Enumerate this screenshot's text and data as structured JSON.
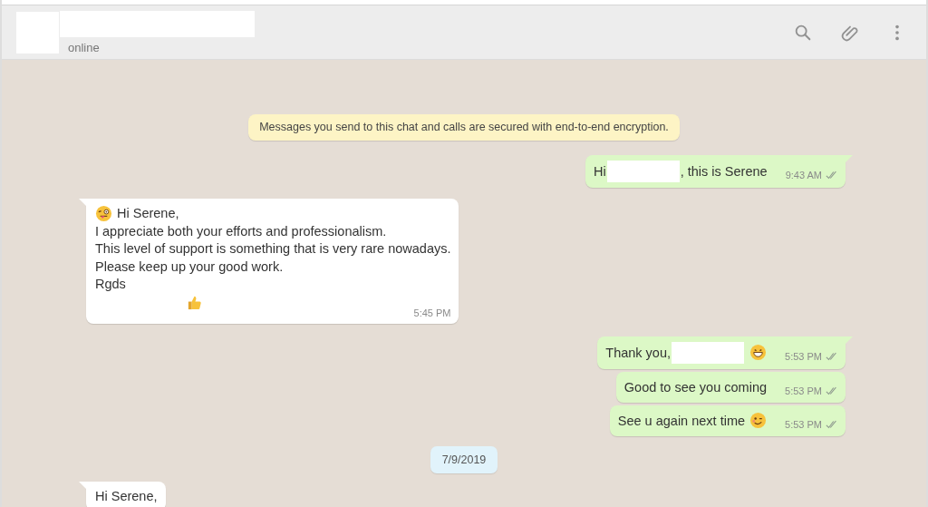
{
  "header": {
    "status": "online"
  },
  "notice": "Messages you send to this chat and calls are secured with end-to-end encryption.",
  "messages": [
    {
      "kind": "out",
      "parts": [
        {
          "kind": "text",
          "text": "Hi"
        },
        {
          "kind": "redaction"
        },
        {
          "kind": "text",
          "text": ", this is Serene"
        }
      ],
      "time": "9:43 AM",
      "read": true,
      "tail": true
    },
    {
      "kind": "in",
      "lines": [
        [
          {
            "kind": "wink"
          },
          {
            "kind": "text",
            "text": "Hi Serene,"
          }
        ],
        [
          {
            "kind": "text",
            "text": "I appreciate both your efforts and professionalism."
          }
        ],
        [
          {
            "kind": "text",
            "text": "This level of support is something that is very rare nowadays."
          }
        ],
        [
          {
            "kind": "text",
            "text": "Please keep up your good work."
          }
        ],
        [
          {
            "kind": "text",
            "text": "Rgds"
          }
        ],
        [
          {
            "kind": "thumbs"
          }
        ]
      ],
      "time": "5:45 PM",
      "tail": true
    },
    {
      "kind": "out",
      "parts": [
        {
          "kind": "text",
          "text": "Thank you,"
        },
        {
          "kind": "redaction"
        },
        {
          "kind": "grin"
        }
      ],
      "time": "5:53 PM",
      "read": true,
      "tail": true
    },
    {
      "kind": "out",
      "parts": [
        {
          "kind": "text",
          "text": "Good to see you coming"
        }
      ],
      "time": "5:53 PM",
      "read": true,
      "tail": false
    },
    {
      "kind": "out",
      "parts": [
        {
          "kind": "text",
          "text": "See u again next time"
        },
        {
          "kind": "smirk"
        }
      ],
      "time": "5:53 PM",
      "read": true,
      "tail": false
    },
    {
      "kind": "date",
      "text": "7/9/2019"
    },
    {
      "kind": "in",
      "lines": [
        [
          {
            "kind": "text",
            "text": "Hi Serene,"
          }
        ]
      ],
      "tail": true
    }
  ]
}
